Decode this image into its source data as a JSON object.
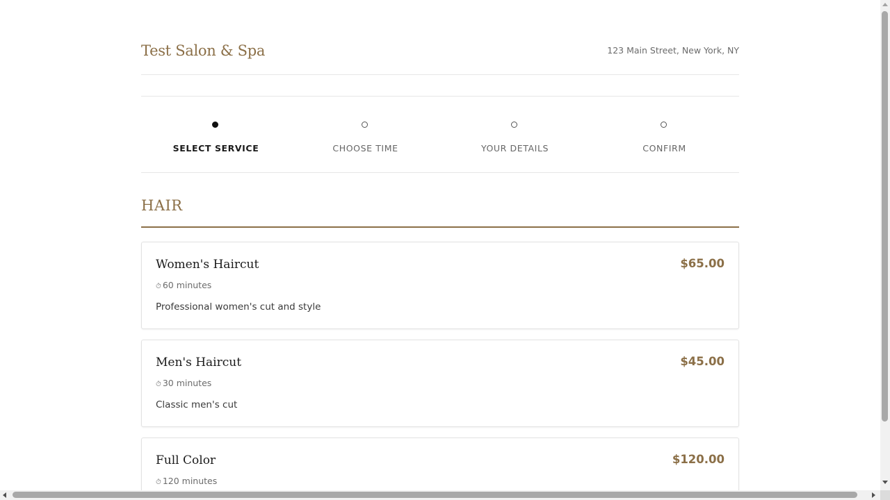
{
  "header": {
    "salon_name": "Test Salon & Spa",
    "address": "123 Main Street, New York, NY"
  },
  "steps": [
    {
      "label": "SELECT SERVICE",
      "active": true
    },
    {
      "label": "CHOOSE TIME",
      "active": false
    },
    {
      "label": "YOUR DETAILS",
      "active": false
    },
    {
      "label": "CONFIRM",
      "active": false
    }
  ],
  "category": {
    "title": "HAIR"
  },
  "services": [
    {
      "name": "Women's Haircut",
      "price": "$65.00",
      "clock_icon": "⏱",
      "duration": "60 minutes",
      "description": "Professional women's cut and style"
    },
    {
      "name": "Men's Haircut",
      "price": "$45.00",
      "clock_icon": "⏱",
      "duration": "30 minutes",
      "description": "Classic men's cut"
    },
    {
      "name": "Full Color",
      "price": "$120.00",
      "clock_icon": "⏱",
      "duration": "120 minutes",
      "description": ""
    }
  ],
  "colors": {
    "accent": "#8b6f47",
    "text_dark": "#1a1a1a",
    "text_muted": "#6b6b6b",
    "border": "#e2e2e2"
  }
}
